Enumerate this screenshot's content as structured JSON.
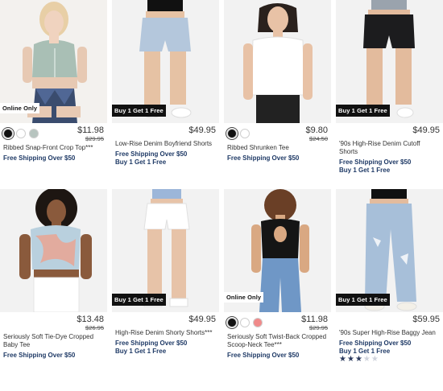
{
  "products": [
    {
      "name": "Ribbed Snap-Front Crop Top***",
      "price": "$11.98",
      "was": "$29.95",
      "badge": "Online Only",
      "swatches": [
        "#111111",
        "#ffffff",
        "#b7c4bf"
      ],
      "promos": [
        "Free Shipping Over $50"
      ]
    },
    {
      "name": "Low-Rise Denim Boyfriend Shorts",
      "price": "$49.95",
      "badge": "Buy 1 Get 1 Free",
      "promos": [
        "Free Shipping Over $50",
        "Buy 1 Get 1 Free"
      ]
    },
    {
      "name": "Ribbed Shrunken Tee",
      "price": "$9.80",
      "was": "$24.50",
      "swatches": [
        "#111111",
        "#ffffff"
      ],
      "promos": [
        "Free Shipping Over $50"
      ]
    },
    {
      "name": "'90s High-Rise Denim Cutoff Shorts",
      "price": "$49.95",
      "badge": "Buy 1 Get 1 Free",
      "promos": [
        "Free Shipping Over $50",
        "Buy 1 Get 1 Free"
      ]
    },
    {
      "name": "Seriously Soft Tie-Dye Cropped Baby Tee",
      "price": "$13.48",
      "was": "$26.95",
      "promos": [
        "Free Shipping Over $50"
      ]
    },
    {
      "name": "High-Rise Denim Shorty Shorts***",
      "price": "$49.95",
      "badge": "Buy 1 Get 1 Free",
      "promos": [
        "Free Shipping Over $50",
        "Buy 1 Get 1 Free"
      ]
    },
    {
      "name": "Seriously Soft Twist-Back Cropped Scoop-Neck Tee***",
      "price": "$11.98",
      "was": "$29.95",
      "badge": "Online Only",
      "swatches": [
        "#111111",
        "#ffffff",
        "#f08a8a"
      ],
      "promos": [
        "Free Shipping Over $50"
      ]
    },
    {
      "name": "'90s Super High-Rise Baggy Jean",
      "price": "$59.95",
      "badge": "Buy 1 Get 1 Free",
      "promos": [
        "Free Shipping Over $50",
        "Buy 1 Get 1 Free"
      ],
      "rating": 3
    }
  ]
}
